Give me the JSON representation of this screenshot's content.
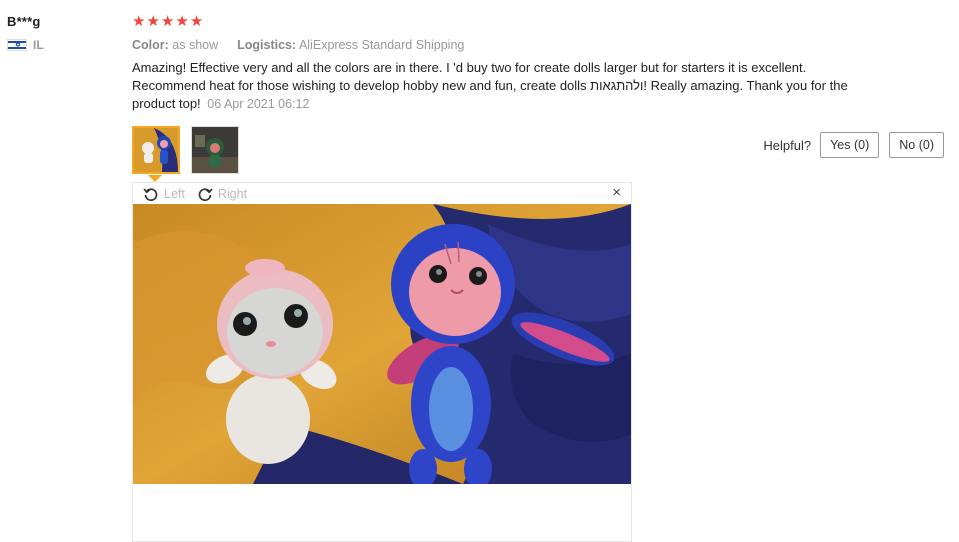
{
  "user": {
    "name": "B***g",
    "country": "IL"
  },
  "rating": {
    "stars": 5,
    "max": 5
  },
  "meta": {
    "color_label": "Color:",
    "color_value": "as show",
    "logistics_label": "Logistics:",
    "logistics_value": "AliExpress Standard Shipping"
  },
  "review": {
    "text": "Amazing! Effective very and all the colors are in there. I 'd buy two for create dolls larger but for starters it is excellent. Recommend heat for those wishing to develop hobby new and fun, create dolls ולהתגאות! Really amazing. Thank you for the product top!",
    "date": "06 Apr 2021 06:12"
  },
  "helpful": {
    "label": "Helpful?",
    "yes": "Yes (0)",
    "no": "No (0)"
  },
  "viewer": {
    "rotate_left": "Left",
    "rotate_right": "Right",
    "close": "×"
  },
  "colors": {
    "star": "#f0443d",
    "active_thumb": "#f5a623",
    "muted": "#999999"
  }
}
